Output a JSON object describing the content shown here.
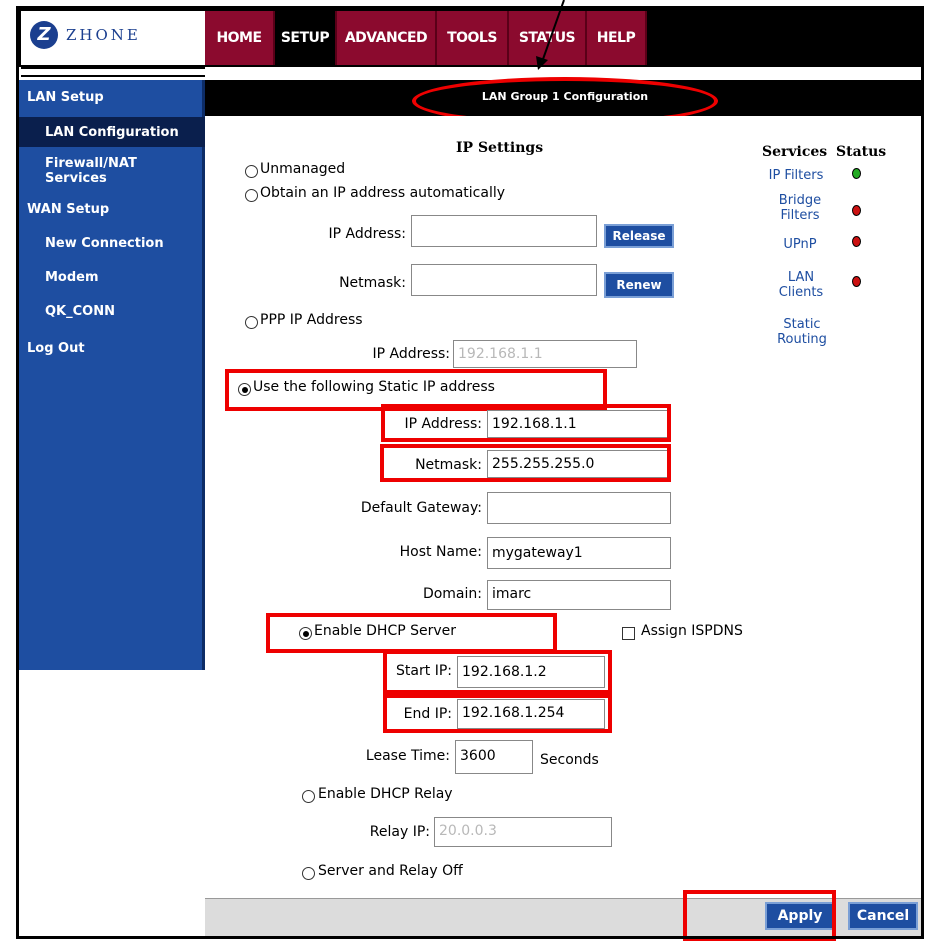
{
  "header": {
    "logo_text": "ZHONE",
    "logo_glyph": "Z",
    "tabs": [
      "HOME",
      "SETUP",
      "ADVANCED",
      "TOOLS",
      "STATUS",
      "HELP"
    ]
  },
  "sidebar": {
    "items": [
      {
        "label": "LAN Setup"
      },
      {
        "label": "LAN Configuration"
      },
      {
        "label": "Firewall/NAT Services"
      },
      {
        "label": "WAN Setup"
      },
      {
        "label": "New Connection"
      },
      {
        "label": "Modem"
      },
      {
        "label": "QK_CONN"
      },
      {
        "label": "Log Out"
      }
    ]
  },
  "title": "LAN Group 1 Configuration",
  "ip_settings": {
    "heading": "IP Settings",
    "unmanaged": "Unmanaged",
    "obtain_auto": "Obtain an IP address automatically",
    "ip_address_label": "IP Address:",
    "ip_address_value": "",
    "release": "Release",
    "netmask_label": "Netmask:",
    "netmask_value": "",
    "renew": "Renew",
    "ppp": "PPP IP Address",
    "ppp_ip_label": "IP Address:",
    "ppp_ip_value": "192.168.1.1",
    "static": "Use the following Static IP address",
    "static_ip_label": "IP Address:",
    "static_ip_value": "192.168.1.1",
    "static_netmask_label": "Netmask:",
    "static_netmask_value": "255.255.255.0",
    "gateway_label": "Default Gateway:",
    "gateway_value": "",
    "hostname_label": "Host Name:",
    "hostname_value": "mygateway1",
    "domain_label": "Domain:",
    "domain_value": "imarc"
  },
  "dhcp": {
    "enable_server": "Enable DHCP Server",
    "assign_ispdns": "Assign ISPDNS",
    "start_ip_label": "Start IP:",
    "start_ip_value": "192.168.1.2",
    "end_ip_label": "End IP:",
    "end_ip_value": "192.168.1.254",
    "lease_label": "Lease Time:",
    "lease_value": "3600",
    "lease_unit": "Seconds",
    "relay": "Enable DHCP Relay",
    "relay_ip_label": "Relay IP:",
    "relay_ip_value": "20.0.0.3",
    "off": "Server and Relay Off"
  },
  "services": {
    "heading_services": "Services",
    "heading_status": "Status",
    "items": [
      {
        "label": "IP Filters",
        "status_color": "#22aa22"
      },
      {
        "label": "Bridge Filters",
        "status_color": "#cc1111"
      },
      {
        "label": "UPnP",
        "status_color": "#cc1111"
      },
      {
        "label": "LAN Clients",
        "status_color": "#cc1111"
      },
      {
        "label": "Static Routing"
      }
    ]
  },
  "footer": {
    "apply": "Apply",
    "cancel": "Cancel"
  },
  "colors": {
    "accent_blue": "#1e4ea1",
    "nav_red": "#8b0a2e",
    "highlight_red": "#e00000"
  }
}
